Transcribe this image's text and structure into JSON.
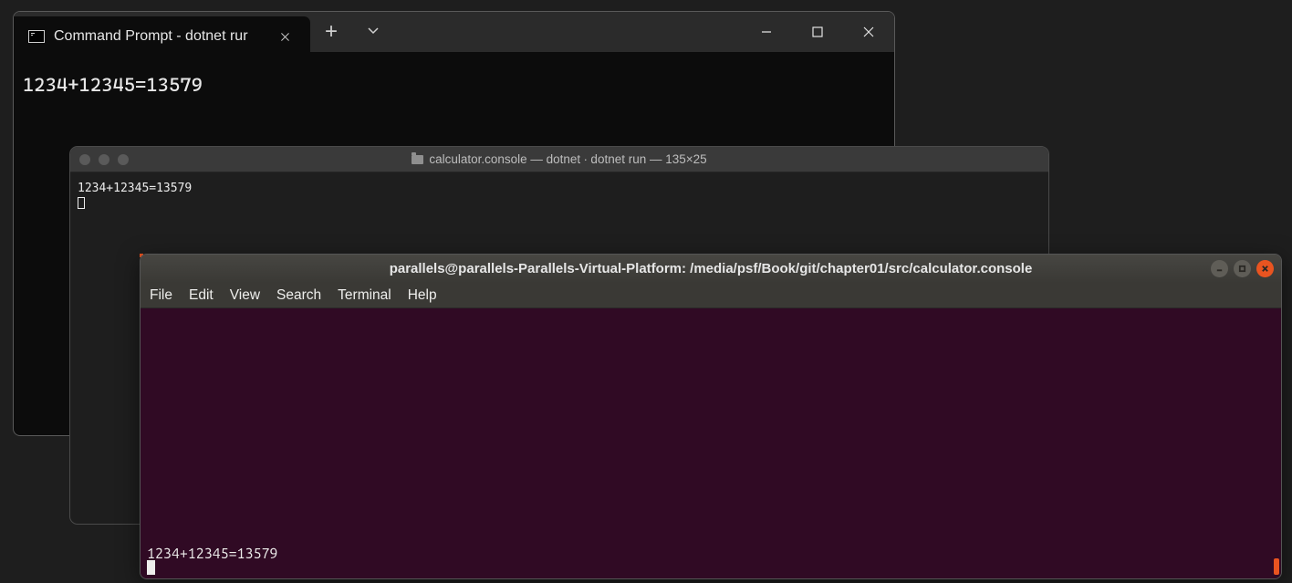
{
  "windowsTerminal": {
    "tabTitle": "Command Prompt - dotnet  rur",
    "output": "1234+12345=13579"
  },
  "macTerminal": {
    "title": "calculator.console — dotnet ∙ dotnet run — 135×25",
    "output": "1234+12345=13579"
  },
  "ubuntuTerminal": {
    "title": "parallels@parallels-Parallels-Virtual-Platform: /media/psf/Book/git/chapter01/src/calculator.console",
    "menu": {
      "file": "File",
      "edit": "Edit",
      "view": "View",
      "search": "Search",
      "terminal": "Terminal",
      "help": "Help"
    },
    "output": "1234+12345=13579"
  }
}
